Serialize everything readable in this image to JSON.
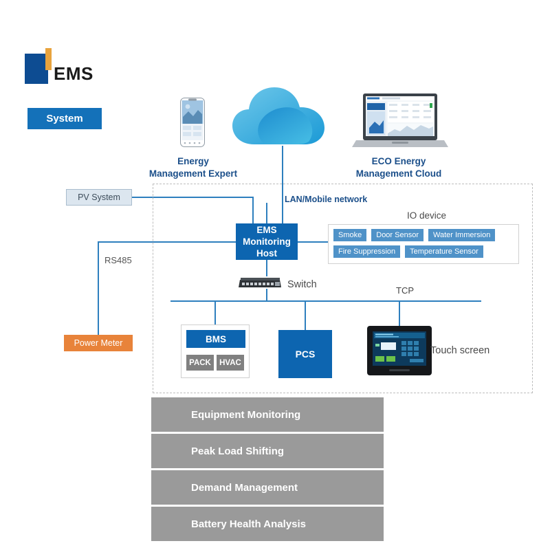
{
  "brand": {
    "title": "EMS",
    "chip_label": "System",
    "logo_icon": "ems-logo-mark",
    "accent_color": "#e8a33d",
    "primary_color": "#0d4c92"
  },
  "top_devices": [
    {
      "icon": "smartphone-icon",
      "caption": "Energy\nManagement Expert",
      "caption_line1": "Energy",
      "caption_line2": "Management Expert"
    },
    {
      "icon": "cloud-icon",
      "caption": ""
    },
    {
      "icon": "laptop-icon",
      "caption_line1": "ECO Energy",
      "caption_line2": "Management Cloud"
    }
  ],
  "wire_labels": {
    "lan": "LAN/Mobile network",
    "rs485": "RS485",
    "tcp": "TCP",
    "switch": "Switch",
    "touch_screen": "Touch screen"
  },
  "external_nodes": [
    {
      "label": "PV System",
      "color": "#dce6ef",
      "text_color": "#3d4c5a"
    },
    {
      "label": "Power Meter",
      "color": "#e8833a",
      "text_color": "#ffffff"
    }
  ],
  "core": {
    "ems_host_line1": "EMS",
    "ems_host_line2": "Monitoring",
    "ems_host_line3": "Host",
    "ems_host_color": "#0d65b0"
  },
  "io_device": {
    "title": "IO device",
    "row1": [
      "Smoke",
      "Door Sensor",
      "Water Immersion"
    ],
    "row2": [
      "Fire Suppression",
      "Temperature Sensor"
    ],
    "tag_color": "#4f92c8"
  },
  "bms_group": {
    "title": "BMS",
    "children": [
      "PACK",
      "HVAC"
    ],
    "title_color": "#0d65b0",
    "child_color": "#808080"
  },
  "pcs": {
    "label": "PCS",
    "color": "#0d65b0"
  },
  "hmi": {
    "label": "Touch screen",
    "icon": "hmi-panel-icon"
  },
  "features": [
    {
      "label": "Equipment Monitoring"
    },
    {
      "label": "Peak Load Shifting"
    },
    {
      "label": "Demand Management"
    },
    {
      "label": "Battery Health Analysis"
    }
  ],
  "feature_bar_color": "#9a9a9a",
  "connector_color": "#2d7fbe"
}
